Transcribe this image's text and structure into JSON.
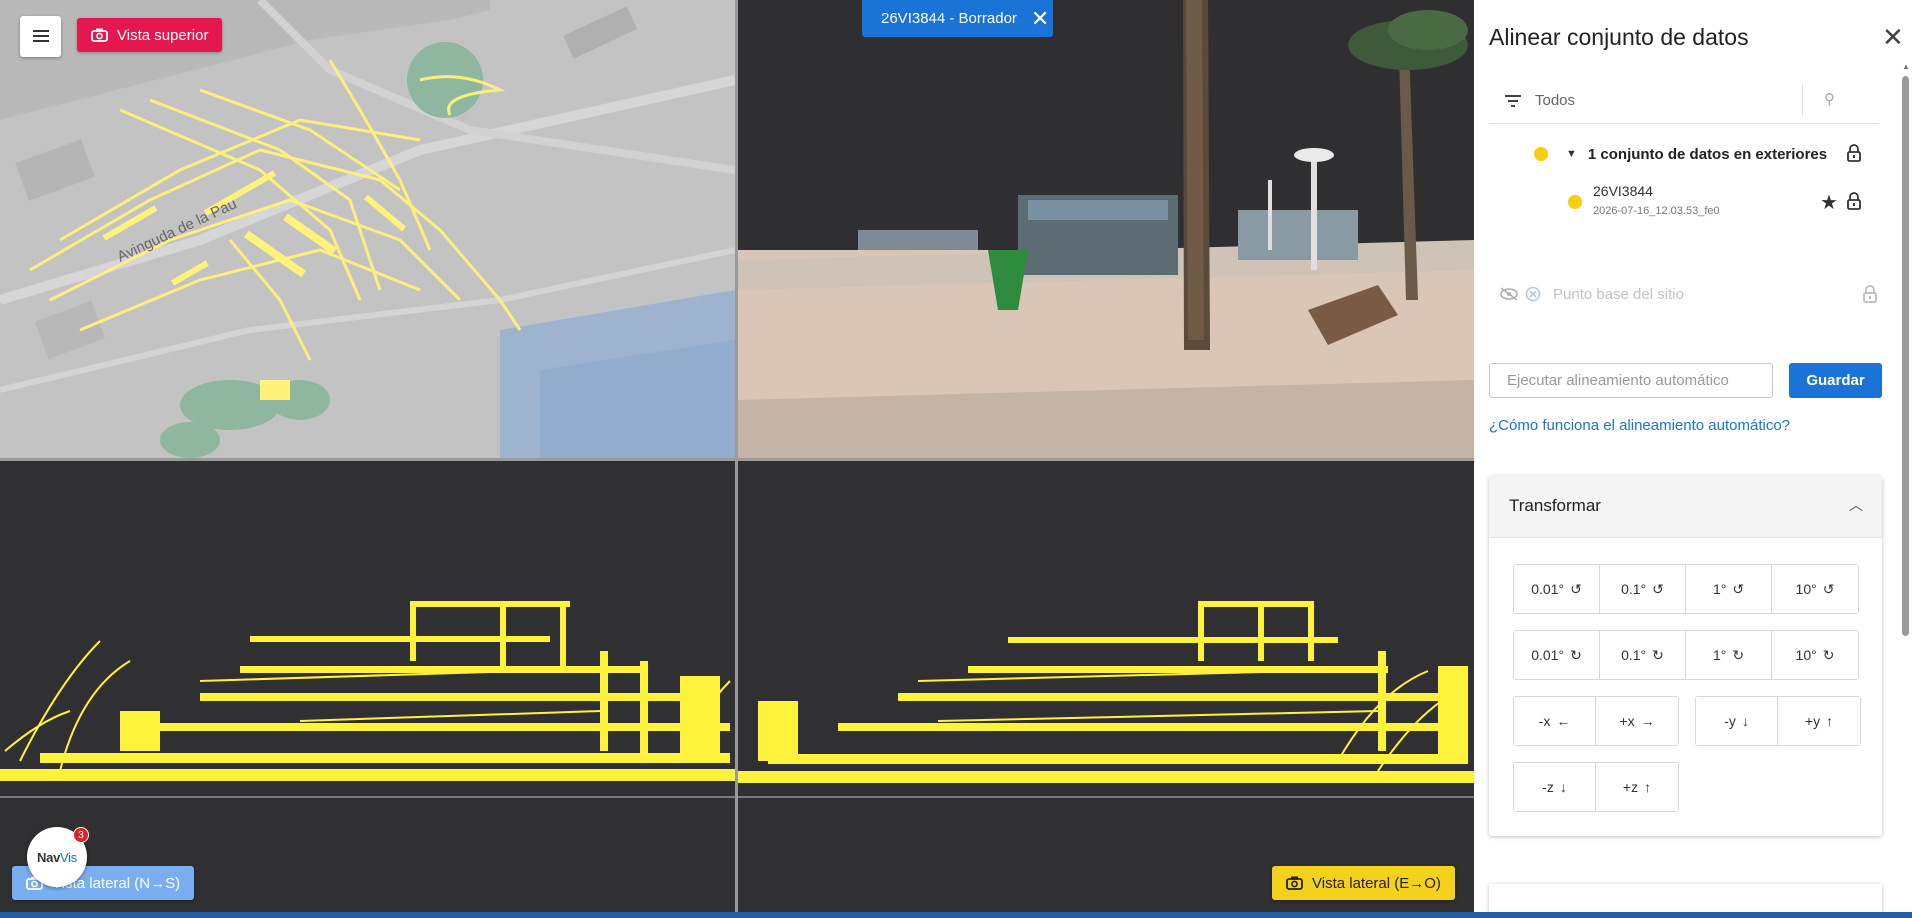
{
  "header": {
    "dataset_tab": "26VI3844 - Borrador"
  },
  "views": {
    "top_label": "Vista superior",
    "side_ns_label": "Vista lateral (N→S)",
    "side_eo_label": "Vista lateral (E→O)",
    "map_street_label": "Avinguda de la Pau"
  },
  "logo": {
    "brand_a": "Nav",
    "brand_b": "Vis",
    "notifications": "3"
  },
  "panel": {
    "title": "Alinear conjunto de datos",
    "filter_label": "Todos",
    "group_label": "1 conjunto de datos en exteriores",
    "dataset": {
      "name": "26VI3844",
      "subtitle": "2026-07-16_12.03.53_fe0"
    },
    "site_base_point": "Punto base del sitio",
    "auto_align_placeholder": "Ejecutar alineamiento automático",
    "save_label": "Guardar",
    "help_link": "¿Cómo funciona el alineamiento automático?",
    "transform": {
      "title": "Transformar",
      "rotate_ccw": [
        "0.01°",
        "0.1°",
        "1°",
        "10°"
      ],
      "rotate_cw": [
        "0.01°",
        "0.1°",
        "1°",
        "10°"
      ],
      "x_neg": "-x",
      "x_pos": "+x",
      "y_neg": "-y",
      "y_pos": "+y",
      "z_neg": "-z",
      "z_pos": "+z"
    }
  },
  "colors": {
    "accent_blue": "#1a73d6",
    "top_view_red": "#e5174f",
    "side_ns_blue": "#79aef0",
    "side_eo_yellow": "#f4d11a",
    "pointcloud_yellow": "#fff35a",
    "dataset_dot": "#f5cf0e"
  }
}
